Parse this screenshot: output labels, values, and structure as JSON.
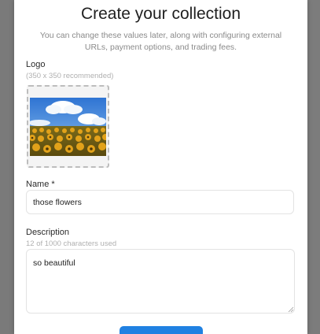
{
  "modal": {
    "title": "Create your collection",
    "subtitle": "You can change these values later, along with configuring external URLs, payment options, and trading fees."
  },
  "logo": {
    "label": "Logo",
    "hint": "(350 x 350 recommended)",
    "image_description": "sunflower field under blue sky"
  },
  "name_field": {
    "label": "Name *",
    "value": "those flowers"
  },
  "description_field": {
    "label": "Description",
    "counter": "12 of 1000 characters used",
    "value": "so beautiful"
  },
  "create_button": {
    "label": ""
  },
  "colors": {
    "accent": "#2081e2",
    "backdrop": "#8e8e8e",
    "muted_text": "#8a8a8a"
  }
}
